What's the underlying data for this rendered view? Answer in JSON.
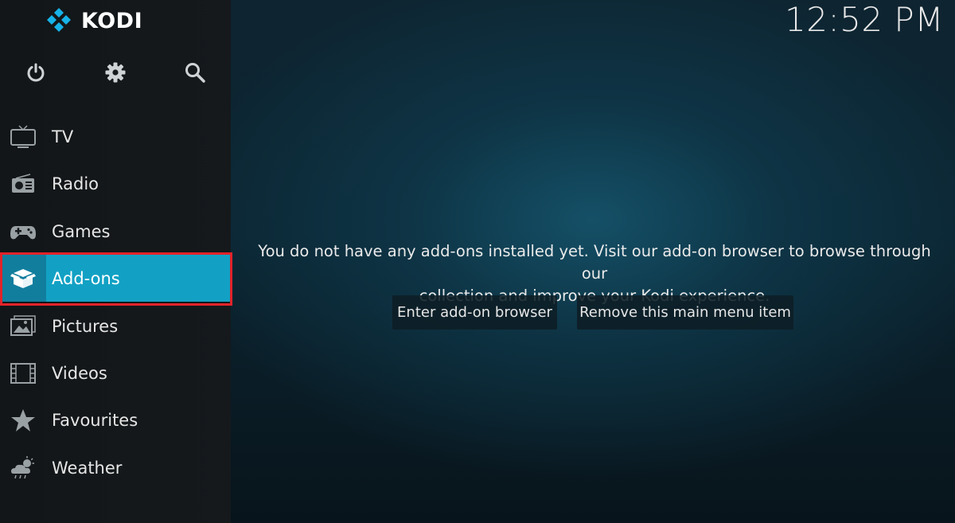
{
  "app": {
    "name": "KODI"
  },
  "clock": {
    "time": "12:52 PM"
  },
  "top_icons": [
    "power-icon",
    "gear-icon",
    "search-icon"
  ],
  "menu": [
    {
      "label": "TV",
      "icon": "tv-icon"
    },
    {
      "label": "Radio",
      "icon": "radio-icon"
    },
    {
      "label": "Games",
      "icon": "gamepad-icon"
    },
    {
      "label": "Add-ons",
      "icon": "box-icon",
      "active": true
    },
    {
      "label": "Pictures",
      "icon": "pictures-icon"
    },
    {
      "label": "Videos",
      "icon": "film-icon"
    },
    {
      "label": "Favourites",
      "icon": "star-icon"
    },
    {
      "label": "Weather",
      "icon": "weather-icon"
    }
  ],
  "main": {
    "message_line1": "You do not have any add-ons installed yet. Visit our add-on browser to browse through our",
    "message_line2": "collection and improve your Kodi experience.",
    "button_browser": "Enter add-on browser",
    "button_remove": "Remove this main menu item"
  },
  "colors": {
    "accent": "#12a1c4",
    "highlight_border": "#e2232a"
  }
}
